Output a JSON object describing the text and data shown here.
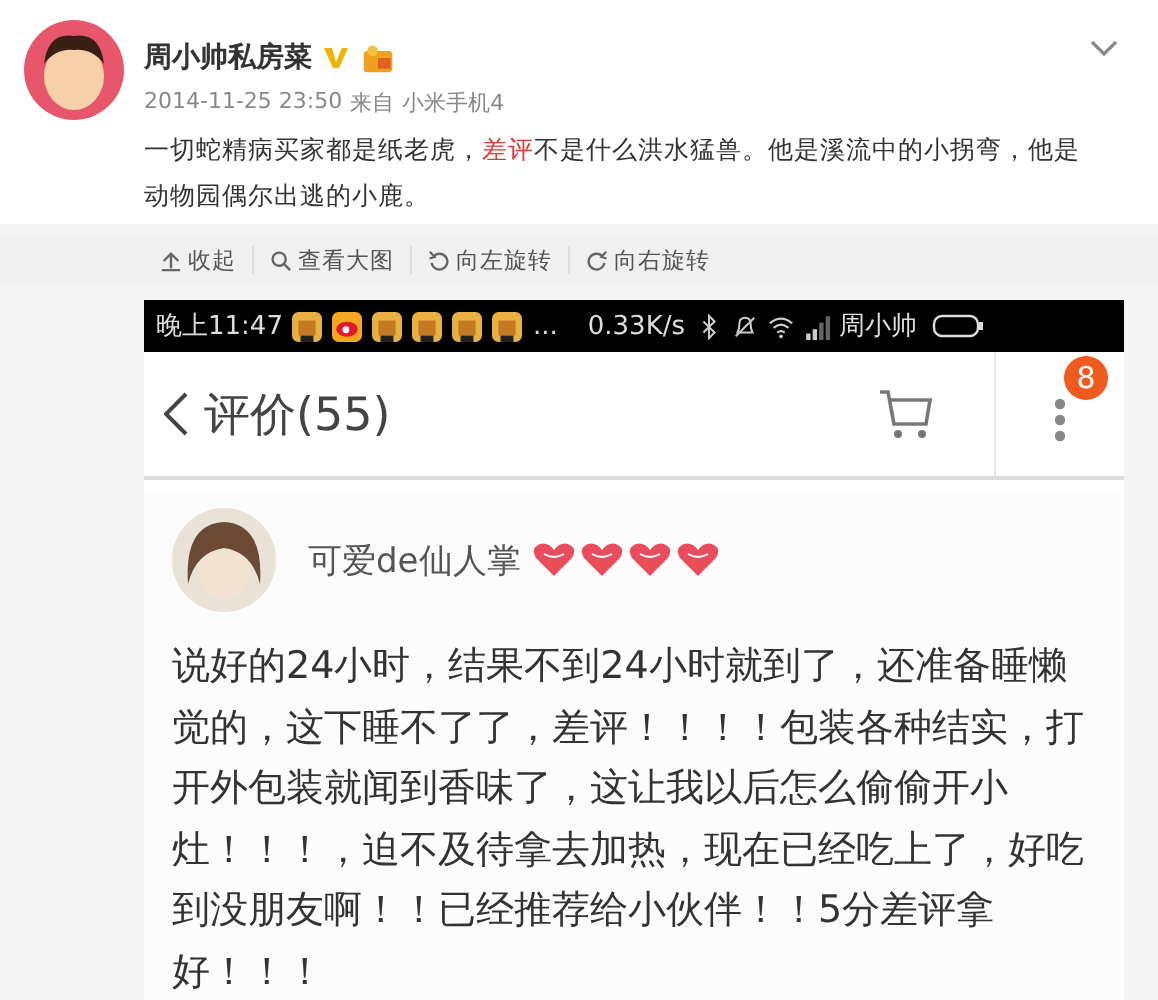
{
  "post": {
    "author": "周小帅私房菜",
    "verified": true,
    "time": "2014-11-25 23:50",
    "source_prefix": "来自",
    "source": "小米手机4",
    "text": [
      {
        "text": "一切蛇精病买家都是纸老虎，",
        "highlight": false
      },
      {
        "text": "差评",
        "highlight": true
      },
      {
        "text": "不是什么洪水猛兽。他是溪流中的小拐弯，他是动物园偶尔出逃的小鹿。",
        "highlight": false
      }
    ]
  },
  "image_toolbar": [
    {
      "label": "收起"
    },
    {
      "label": "查看大图"
    },
    {
      "label": "向左旋转"
    },
    {
      "label": "向右旋转"
    }
  ],
  "phone": {
    "status_bar": {
      "time": "晚上11:47",
      "more": "...",
      "speed": "0.33K/s",
      "carrier": "周小帅"
    },
    "header": {
      "title": "评价(55)",
      "badge": "8"
    },
    "review": {
      "user": "可爱de仙人掌",
      "text": "说好的24小时，结果不到24小时就到了，还准备睡懒觉的，这下睡不了了，差评！！！！包装各种结实，打开外包装就闻到香味了，这让我以后怎么偷偷开小灶！！！，迫不及待拿去加热，现在已经吃上了，好吃到没朋友啊！！已经推荐给小伙伴！！5分差评拿好！！！"
    }
  }
}
